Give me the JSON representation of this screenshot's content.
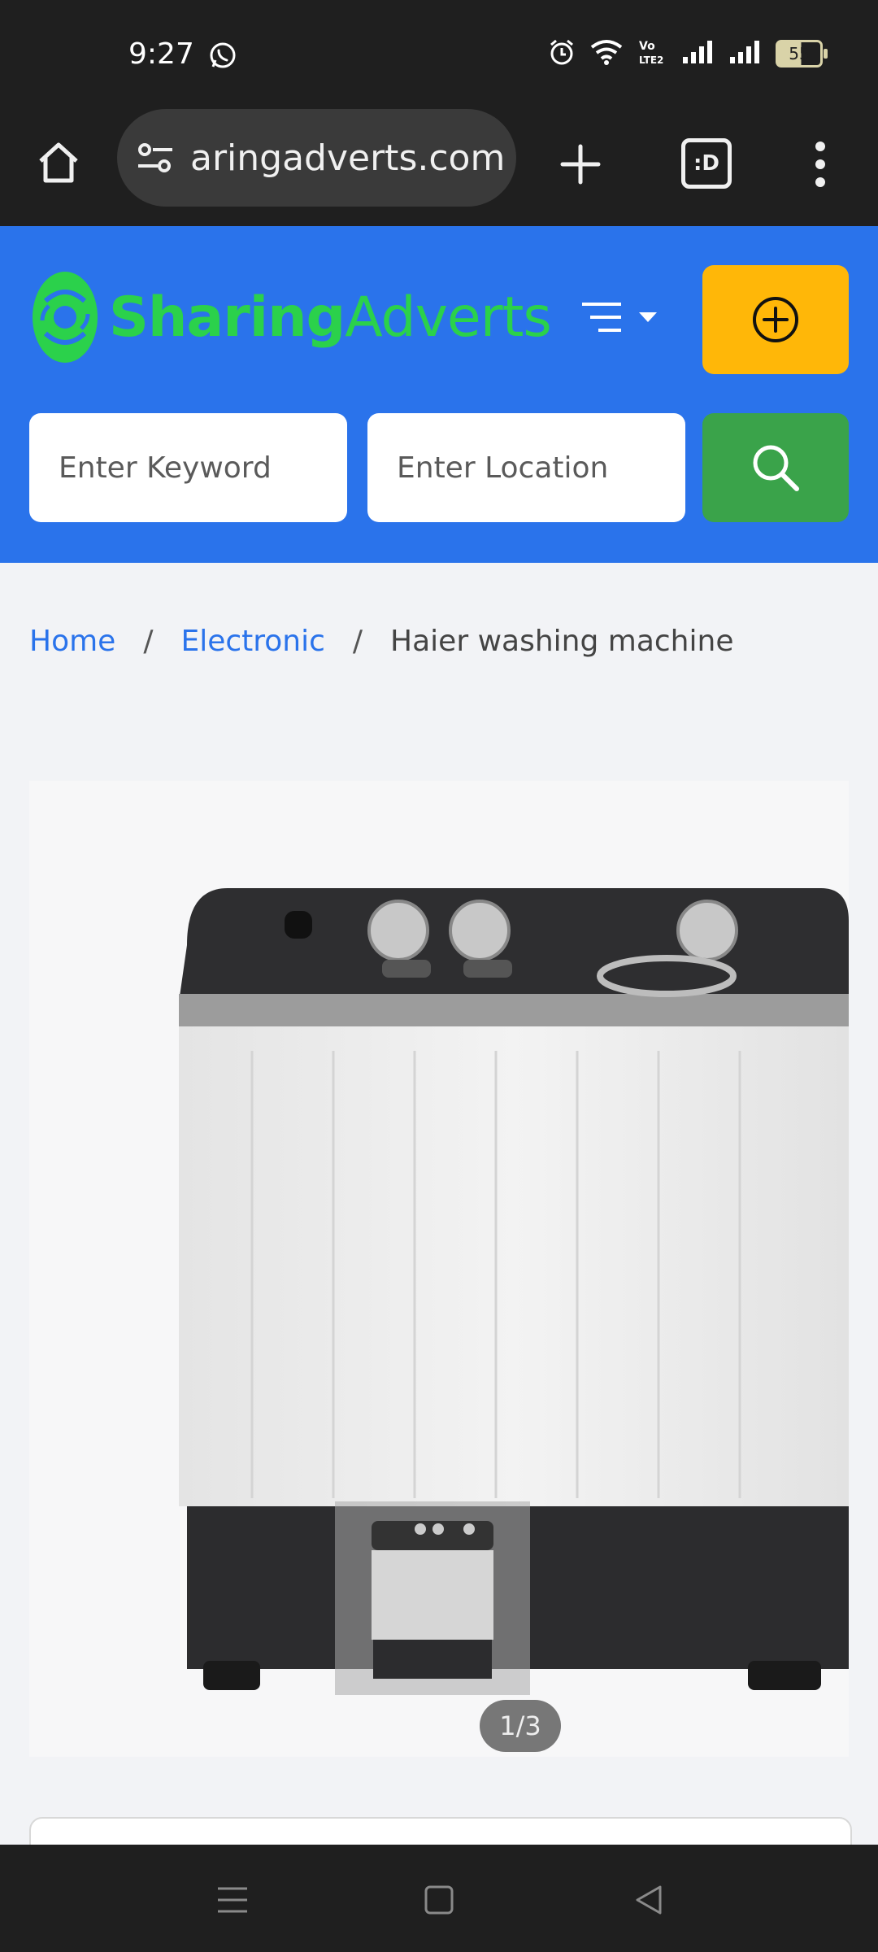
{
  "status_bar": {
    "time": "9:27",
    "battery_level": "55"
  },
  "browser": {
    "url": "aringadverts.com",
    "tabs_label": ":D"
  },
  "site": {
    "logo": {
      "part1": "Sharing",
      "part2": "Adverts"
    },
    "search": {
      "keyword_placeholder": "Enter Keyword",
      "location_placeholder": "Enter Location"
    }
  },
  "breadcrumb": {
    "items": [
      "Home",
      "Electronic"
    ],
    "current": "Haier washing machine",
    "separator": "/"
  },
  "gallery": {
    "counter": "1/3"
  },
  "colors": {
    "header_blue": "#2a73eb",
    "post_button_yellow": "#ffb708",
    "search_button_green": "#3aa34a",
    "logo_green": "#2bd14b"
  }
}
